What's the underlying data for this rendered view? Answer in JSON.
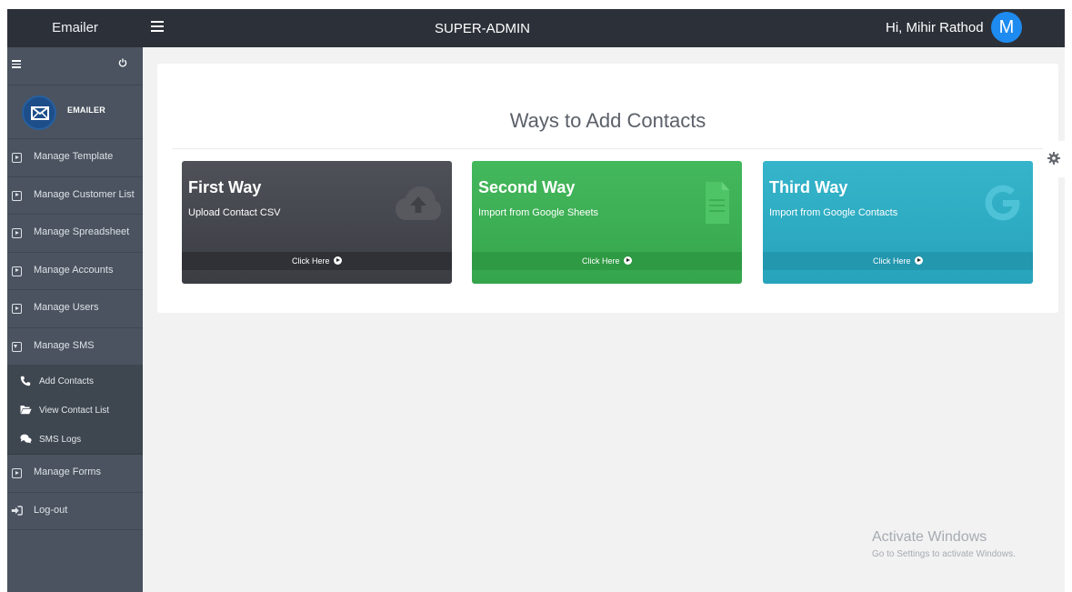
{
  "header": {
    "brand": "Emailer",
    "title": "SUPER-ADMIN",
    "greeting": "Hi, Mihir Rathod",
    "avatar_letter": "M",
    "avatar_color": "#1e8bf0",
    "background_color": "#2c3139"
  },
  "sidebar": {
    "brand_text": "EMAILER",
    "background_color": "#4a535f",
    "items": [
      {
        "label": "Manage Template",
        "icon": "square-caret-right-icon"
      },
      {
        "label": "Manage Customer List",
        "icon": "square-caret-right-icon"
      },
      {
        "label": "Manage Spreadsheet",
        "icon": "square-caret-right-icon"
      },
      {
        "label": "Manage Accounts",
        "icon": "square-caret-right-icon"
      },
      {
        "label": "Manage Users",
        "icon": "square-caret-right-icon"
      },
      {
        "label": "Manage SMS",
        "icon": "square-caret-down-icon"
      }
    ],
    "submenu": [
      {
        "label": "Add Contacts",
        "icon": "phone-icon"
      },
      {
        "label": "View Contact List",
        "icon": "folder-open-icon"
      },
      {
        "label": "SMS Logs",
        "icon": "comments-icon"
      }
    ],
    "after_items": [
      {
        "label": "Manage Forms",
        "icon": "square-caret-right-icon"
      }
    ],
    "logout_label": "Log-out"
  },
  "main": {
    "title": "Ways to Add Contacts",
    "cards": [
      {
        "title": "First Way",
        "subtitle": "Upload Contact CSV",
        "footer": "Click Here",
        "icon": "cloud-upload-icon",
        "color": "#45484e"
      },
      {
        "title": "Second Way",
        "subtitle": "Import from Google Sheets",
        "footer": "Click Here",
        "icon": "file-text-icon",
        "color": "#3dae54"
      },
      {
        "title": "Third Way",
        "subtitle": "Import from Google Contacts",
        "footer": "Click Here",
        "icon": "google-icon",
        "color": "#2eabc2"
      }
    ]
  },
  "watermark": {
    "line1": "Activate Windows",
    "line2": "Go to Settings to activate Windows."
  }
}
